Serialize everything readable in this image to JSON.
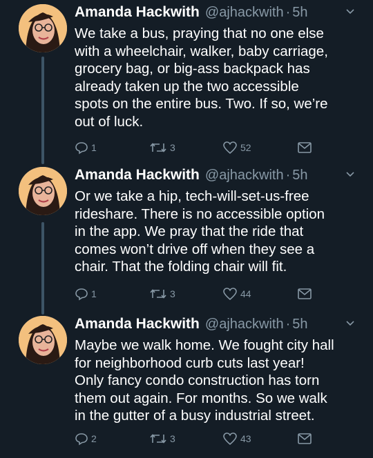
{
  "tweets": [
    {
      "name": "Amanda Hackwith",
      "handle": "@ajhackwith",
      "separator": "·",
      "time": "5h",
      "lines": [
        "We take a bus, praying that no one else",
        "with a wheelchair, walker, baby carriage,",
        "grocery bag, or big-ass backpack has",
        "already taken up the two accessible",
        "spots on the entire bus. Two. If so, we’re",
        "out of luck."
      ],
      "replies": "1",
      "retweets": "3",
      "likes": "52"
    },
    {
      "name": "Amanda Hackwith",
      "handle": "@ajhackwith",
      "separator": "·",
      "time": "5h",
      "lines": [
        "Or we take a hip, tech-will-set-us-free",
        "rideshare. There is no accessible option",
        "in the app. We pray that the ride that",
        "comes won’t drive off when they see a",
        "chair. That the folding chair will fit."
      ],
      "replies": "1",
      "retweets": "3",
      "likes": "44"
    },
    {
      "name": "Amanda Hackwith",
      "handle": "@ajhackwith",
      "separator": "·",
      "time": "5h",
      "lines": [
        "Maybe we walk home. We fought city hall",
        "for neighborhood curb cuts last year!",
        "Only fancy condo construction has torn",
        "them out again. For months. So we walk",
        "in the gutter of a busy industrial street."
      ],
      "replies": "2",
      "retweets": "3",
      "likes": "43"
    }
  ],
  "icons": {
    "reply": "reply-icon",
    "retweet": "retweet-icon",
    "like": "heart-icon",
    "dm": "mail-icon",
    "more": "chevron-down-icon"
  },
  "colors": {
    "background": "#141d26",
    "secondary_text": "#8899a6",
    "thread_line": "#3d5466"
  }
}
